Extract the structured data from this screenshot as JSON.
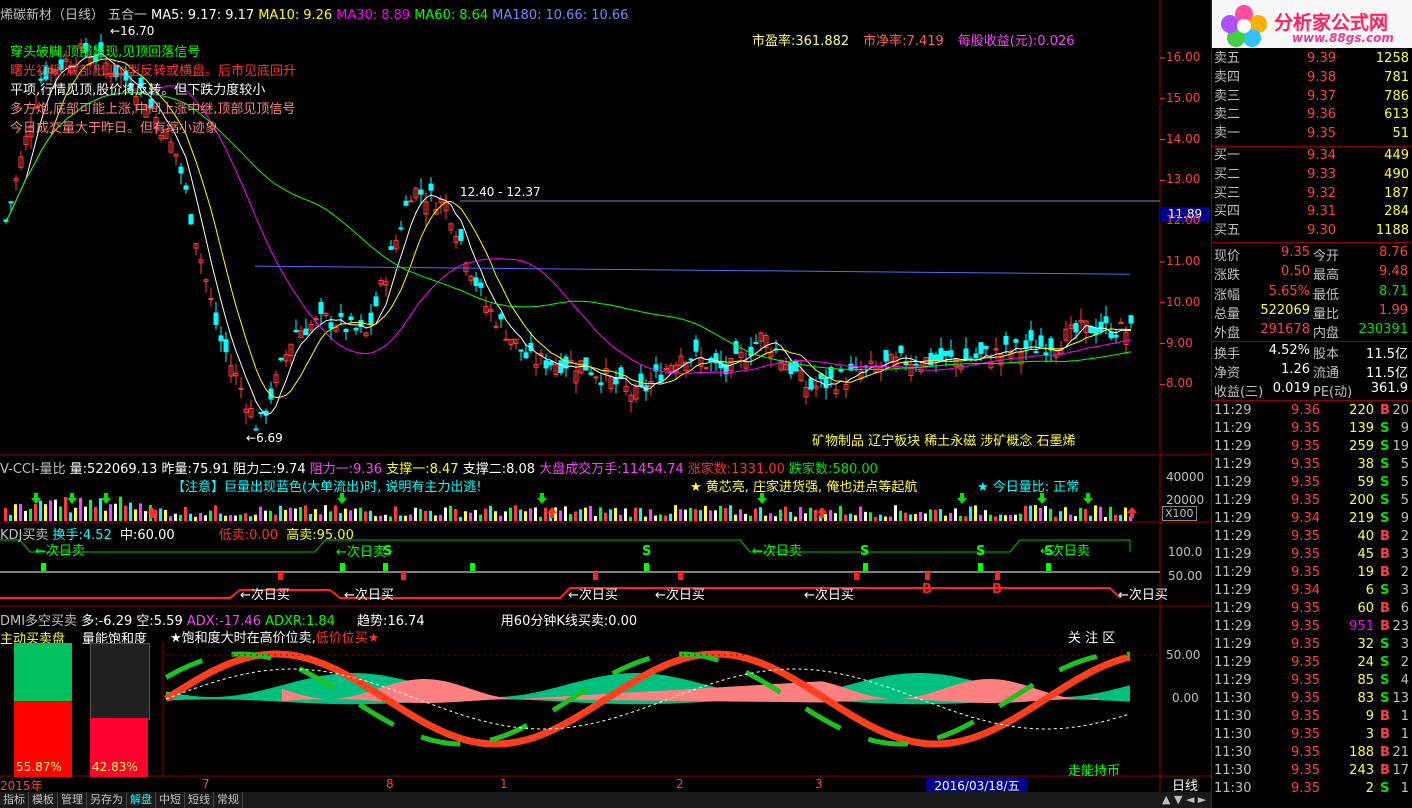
{
  "header": {
    "stock": "烯碳新材（日线）",
    "formula": "五合一",
    "ma5_label": "MA5:",
    "ma5": "9.17",
    "ma5b": ": 9.17",
    "ma10_label": "MA10:",
    "ma10": "9.26",
    "ma30_label": "MA30:",
    "ma30": "8.89",
    "ma60_label": "MA60:",
    "ma60": "8.64",
    "ma180_label": "MA180:",
    "ma180": "10.66",
    "ma180b": ": 10.66"
  },
  "ratios": {
    "pe_label": "市盈率:",
    "pe": "361.882",
    "pb_label": "市净率:",
    "pb": "7.419",
    "eps_label": "每股收益(元):",
    "eps": "0.026"
  },
  "notes": [
    {
      "text": "穿头破脚,顶部出现,见顶回落信号",
      "color": "#00ff00"
    },
    {
      "text": "曙光初现,底部出现V型反转或横盘。后市见底回升",
      "color": "#ff3030"
    },
    {
      "text": "平项,行情见顶,股价将反转。但下跌力度较小",
      "color": "#ffffff"
    },
    {
      "text": "多方炮,底部可能上涨,中间上涨中继,顶部见顶信号",
      "color": "#ff8080"
    },
    {
      "text": "今日成交量大于昨日。但有缩小迹象",
      "color": "#ff8080"
    }
  ],
  "annotations": {
    "high": "16.70",
    "low": "6.69",
    "range": "12.40 - 12.37",
    "price_tag": "11.89"
  },
  "concepts": "矿物制品  辽宁板块  稀土永磁  涉矿概念  石墨烯",
  "price_axis": [
    "16.00",
    "15.00",
    "14.00",
    "13.00",
    "12.00",
    "11.00",
    "10.00",
    "9.00",
    "8.00"
  ],
  "vol_header": {
    "name": "V-CCI-量比",
    "vol_label": "量:",
    "vol": "522069.13",
    "prev_label": "昨量:",
    "prev": "75.91",
    "r2_label": "阻力二:",
    "r2": "9.74",
    "r1_label": "阻力一:",
    "r1": "9.36",
    "s1_label": "支撑一:",
    "s1": "8.47",
    "s2_label": "支撑二:",
    "s2": "8.08",
    "mkt_label": "大盘成交万手:",
    "mkt": "11454.74",
    "up_label": "涨家数:",
    "up": "1331.00",
    "down_label": "跌家数:",
    "down": "580.00"
  },
  "vol_notice": "【注意】巨量出现蓝色(大单流出)时, 说明有主力出逃!",
  "vol_star1": "★ 黄芯亮, 庄家进货强, 俺也进点等起航",
  "vol_star2": "★ 今日量比: 正常",
  "vol_axis": [
    "40000",
    "20000",
    "X100"
  ],
  "kdj_header": {
    "name": "KDJ买卖",
    "sw_label": "换手:",
    "sw": "4.52",
    "mid_label": "中:",
    "mid": "60.00",
    "low_label": "低卖:",
    "low": "0.00",
    "high_label": "高卖:",
    "high": "95.00"
  },
  "kdj_axis": [
    "100.0",
    "50.00"
  ],
  "kdj_sell": "←次日卖",
  "kdj_buy": "←次日买",
  "kdj_s": "S",
  "kdj_b": "B",
  "dmi_header": {
    "name": "DMI多空买卖",
    "duo_label": "多:",
    "duo": "-6.29",
    "kong_label": "空:",
    "kong": "5.59",
    "adx_label": "ADX:",
    "adx": "-17.46",
    "adxr_label": "ADXR:",
    "adxr": "1.84",
    "trend_label": "趋势:",
    "trend": "16.74",
    "k60_label": "用60分钟K线买卖:",
    "k60": "0.00"
  },
  "dmi_legend": {
    "box1": "主动买卖盘",
    "box2": "量能饱和度",
    "tip1": "★饱和度大时在高价位卖,",
    "tip2": "低价位买★",
    "focus": "关 注 区",
    "pct1": "55.87%",
    "pct2": "42.83%",
    "footer": "走能持币"
  },
  "dmi_axis": [
    "50.00",
    "0.00"
  ],
  "date_axis": {
    "year": "2015年",
    "m7": "7",
    "m8": "8",
    "m1": "1",
    "m2": "2",
    "m3": "3",
    "cursor": "2016/03/18/五",
    "period": "日线"
  },
  "bottom_tabs": [
    "指标",
    "模板",
    "管理",
    "另存为",
    "解盘",
    "中短",
    "短线",
    "常规"
  ],
  "orderbook": {
    "asks": [
      {
        "label": "卖五",
        "price": "9.39",
        "vol": "1258"
      },
      {
        "label": "卖四",
        "price": "9.38",
        "vol": "781"
      },
      {
        "label": "卖三",
        "price": "9.37",
        "vol": "786"
      },
      {
        "label": "卖二",
        "price": "9.36",
        "vol": "613"
      },
      {
        "label": "卖一",
        "price": "9.35",
        "vol": "51"
      }
    ],
    "bids": [
      {
        "label": "买一",
        "price": "9.34",
        "vol": "449"
      },
      {
        "label": "买二",
        "price": "9.33",
        "vol": "490"
      },
      {
        "label": "买三",
        "price": "9.32",
        "vol": "187"
      },
      {
        "label": "买四",
        "price": "9.31",
        "vol": "284"
      },
      {
        "label": "买五",
        "price": "9.30",
        "vol": "1188"
      }
    ]
  },
  "quote": [
    {
      "l1": "现价",
      "v1": "9.35",
      "c1": "red",
      "l2": "今开",
      "v2": "8.76",
      "c2": "red"
    },
    {
      "l1": "涨跌",
      "v1": "0.50",
      "c1": "red",
      "l2": "最高",
      "v2": "9.48",
      "c2": "red"
    },
    {
      "l1": "涨幅",
      "v1": "5.65%",
      "c1": "red",
      "l2": "最低",
      "v2": "8.71",
      "c2": "grn"
    },
    {
      "l1": "总量",
      "v1": "522069",
      "c1": "yel",
      "l2": "量比",
      "v2": "1.99",
      "c2": "red"
    },
    {
      "l1": "外盘",
      "v1": "291678",
      "c1": "red",
      "l2": "内盘",
      "v2": "230391",
      "c2": "grn"
    }
  ],
  "quote2": [
    {
      "l1": "换手",
      "v1": "4.52%",
      "l2": "股本",
      "v2": "11.5亿"
    },
    {
      "l1": "净资",
      "v1": "1.26",
      "l2": "流通",
      "v2": "11.5亿"
    },
    {
      "l1": "收益(三)",
      "v1": "0.019",
      "l2": "PE(动)",
      "v2": "361.9"
    }
  ],
  "ticks": [
    {
      "t": "11:29",
      "p": "9.36",
      "q": "220",
      "bs": "B",
      "n": "20"
    },
    {
      "t": "11:29",
      "p": "9.35",
      "q": "139",
      "bs": "S",
      "n": "9"
    },
    {
      "t": "11:29",
      "p": "9.35",
      "q": "259",
      "bs": "S",
      "n": "19"
    },
    {
      "t": "11:29",
      "p": "9.35",
      "q": "38",
      "bs": "S",
      "n": "5"
    },
    {
      "t": "11:29",
      "p": "9.35",
      "q": "59",
      "bs": "S",
      "n": "5"
    },
    {
      "t": "11:29",
      "p": "9.35",
      "q": "200",
      "bs": "S",
      "n": "5"
    },
    {
      "t": "11:29",
      "p": "9.34",
      "q": "219",
      "bs": "S",
      "n": "9"
    },
    {
      "t": "11:29",
      "p": "9.35",
      "q": "40",
      "bs": "B",
      "n": "2"
    },
    {
      "t": "11:29",
      "p": "9.35",
      "q": "45",
      "bs": "B",
      "n": "3"
    },
    {
      "t": "11:29",
      "p": "9.35",
      "q": "19",
      "bs": "B",
      "n": "2"
    },
    {
      "t": "11:29",
      "p": "9.34",
      "q": "6",
      "bs": "S",
      "n": "3"
    },
    {
      "t": "11:29",
      "p": "9.35",
      "q": "60",
      "bs": "B",
      "n": "6"
    },
    {
      "t": "11:29",
      "p": "9.35",
      "q": "951",
      "bs": "B",
      "n": "23"
    },
    {
      "t": "11:29",
      "p": "9.35",
      "q": "32",
      "bs": "S",
      "n": "3"
    },
    {
      "t": "11:29",
      "p": "9.35",
      "q": "24",
      "bs": "S",
      "n": "2"
    },
    {
      "t": "11:29",
      "p": "9.35",
      "q": "85",
      "bs": "S",
      "n": "4"
    },
    {
      "t": "11:30",
      "p": "9.35",
      "q": "83",
      "bs": "S",
      "n": "13"
    },
    {
      "t": "11:30",
      "p": "9.35",
      "q": "9",
      "bs": "B",
      "n": "1"
    },
    {
      "t": "11:30",
      "p": "9.35",
      "q": "3",
      "bs": "B",
      "n": "1"
    },
    {
      "t": "11:30",
      "p": "9.35",
      "q": "188",
      "bs": "B",
      "n": "21"
    },
    {
      "t": "11:30",
      "p": "9.35",
      "q": "243",
      "bs": "B",
      "n": "17"
    },
    {
      "t": "11:30",
      "p": "9.35",
      "q": "2",
      "bs": "S",
      "n": "1"
    }
  ],
  "logo_text": "分析家公式网",
  "logo_url": "www.88gs.com",
  "colors": {
    "up": "#ff3c3c",
    "down": "#00ffff",
    "ma5": "#ffffff",
    "ma10": "#ffff00",
    "ma30": "#ff00ff",
    "ma60": "#00ff00",
    "ma180": "#4a6cff",
    "frame": "#8b0000"
  }
}
